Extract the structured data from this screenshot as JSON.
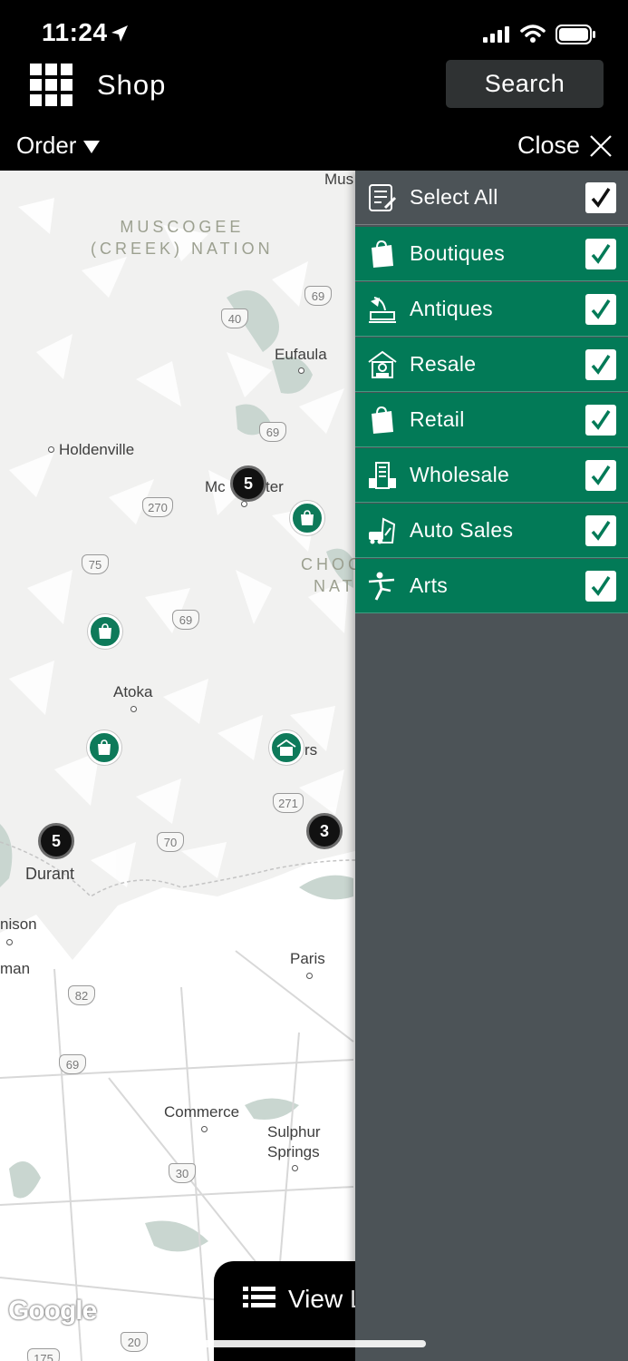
{
  "status_bar": {
    "time": "11:24"
  },
  "header": {
    "title": "Shop",
    "search_label": "Search",
    "order_label": "Order",
    "close_label": "Close"
  },
  "map": {
    "regions": [
      "MUSCOGEE",
      "(CREEK) NATION",
      "CHOC",
      "NAT"
    ],
    "places": {
      "mus": "Mus",
      "eufaula": "Eufaula",
      "holdenville": "Holdenville",
      "mcalester": "Mc",
      "mcalester_tail": "ter",
      "atoka": "Atoka",
      "antlers_tail": "rs",
      "durant": "Durant",
      "denison": "nison",
      "sherman": "man",
      "paris": "Paris",
      "commerce": "Commerce",
      "sulphur": "Sulphur",
      "springs": "Springs"
    },
    "highways": {
      "us69_a": "69",
      "i40": "40",
      "us69_b": "69",
      "us270": "270",
      "us75": "75",
      "us69_c": "69",
      "us271": "271",
      "us70": "70",
      "us82": "82",
      "us69_d": "69",
      "i30": "30",
      "i20": "20",
      "us175": "175"
    },
    "clusters": {
      "mcalester": "5",
      "durant": "5",
      "hugo": "3"
    },
    "google_label": "Google",
    "view_list_label": "View L"
  },
  "filters": {
    "select_all": {
      "label": "Select All",
      "checked": true
    },
    "items": [
      {
        "label": "Boutiques",
        "icon": "shopping-bag-icon",
        "checked": true
      },
      {
        "label": "Antiques",
        "icon": "gramophone-icon",
        "checked": true
      },
      {
        "label": "Resale",
        "icon": "store-house-icon",
        "checked": true
      },
      {
        "label": "Retail",
        "icon": "shopping-bag-icon",
        "checked": true
      },
      {
        "label": "Wholesale",
        "icon": "warehouse-icon",
        "checked": true
      },
      {
        "label": "Auto Sales",
        "icon": "car-tag-icon",
        "checked": true
      },
      {
        "label": "Arts",
        "icon": "dancer-icon",
        "checked": true
      }
    ]
  },
  "colors": {
    "accent": "#027a57",
    "panel": "#4c5357",
    "header": "#000000",
    "map_bg": "#f1f1f0"
  }
}
